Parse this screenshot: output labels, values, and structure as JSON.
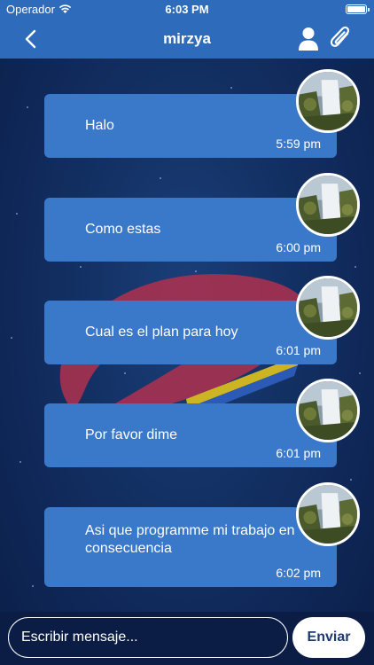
{
  "status_bar": {
    "carrier": "Operador",
    "time": "6:03 PM",
    "battery_level": 1.0
  },
  "nav": {
    "title": "mirzya",
    "back_icon": "chevron-left-icon",
    "profile_icon": "person-icon",
    "attach_icon": "paperclip-icon"
  },
  "messages": [
    {
      "text": "Halo",
      "time": "5:59 pm"
    },
    {
      "text": "Como estas",
      "time": "6:00 pm"
    },
    {
      "text": "Cual es el plan para hoy",
      "time": "6:01 pm"
    },
    {
      "text": "Por favor dime",
      "time": "6:01 pm"
    },
    {
      "text": "Asi que programme mi trabajo en consecuencia",
      "time": "6:02 pm"
    }
  ],
  "composer": {
    "placeholder": "Escribir mensaje...",
    "send_label": "Enviar"
  },
  "colors": {
    "bar": "#2f6bbb",
    "bubble": "#3a78c9",
    "background": "#0f2757"
  }
}
